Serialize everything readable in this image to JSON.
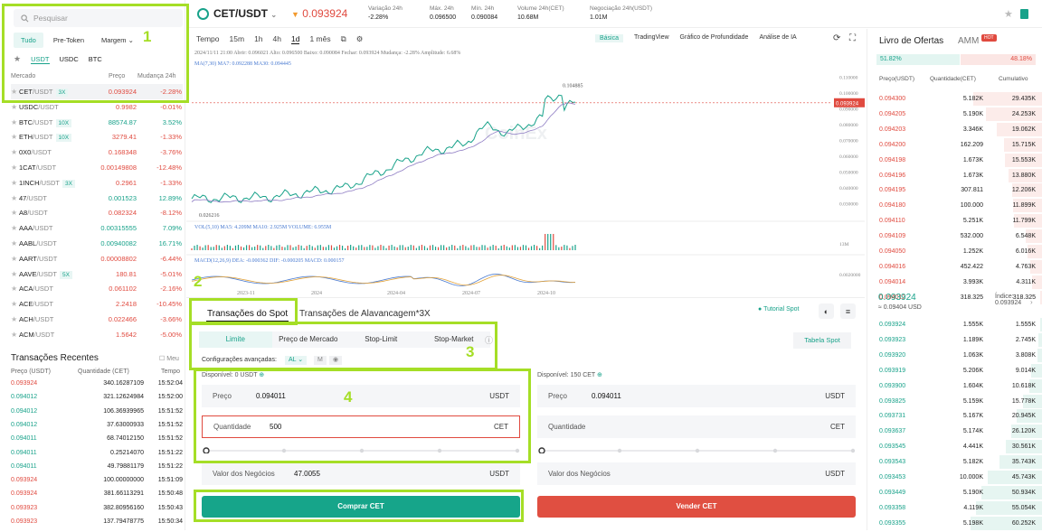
{
  "colors": {
    "up": "#18a28a",
    "down": "#e04a3f",
    "accent": "#18a28a",
    "annotation": "#a5de26"
  },
  "left": {
    "search_placeholder": "Pesquisar",
    "market_tabs": [
      "Tudo",
      "Pre-Token",
      "Margem"
    ],
    "quote_tabs": [
      "USDT",
      "USDC",
      "BTC"
    ],
    "headers": {
      "market": "Mercado",
      "price": "Preço",
      "change": "Mudança 24h"
    },
    "markets": [
      {
        "base": "CET",
        "quote": "/USDT",
        "lev": "3X",
        "price": "0.093924",
        "change": "-2.28%",
        "dir": "neg"
      },
      {
        "base": "USDC",
        "quote": "/USDT",
        "lev": "",
        "price": "0.9982",
        "change": "-0.01%",
        "dir": "neg"
      },
      {
        "base": "BTC",
        "quote": "/USDT",
        "lev": "10X",
        "price": "88574.87",
        "change": "3.52%",
        "dir": "pos"
      },
      {
        "base": "ETH",
        "quote": "/USDT",
        "lev": "10X",
        "price": "3279.41",
        "change": "-1.33%",
        "dir": "neg"
      },
      {
        "base": "0X0",
        "quote": "/USDT",
        "lev": "",
        "price": "0.168348",
        "change": "-3.76%",
        "dir": "neg"
      },
      {
        "base": "1CAT",
        "quote": "/USDT",
        "lev": "",
        "price": "0.00149808",
        "change": "-12.48%",
        "dir": "neg"
      },
      {
        "base": "1INCH",
        "quote": "/USDT",
        "lev": "3X",
        "price": "0.2961",
        "change": "-1.33%",
        "dir": "neg"
      },
      {
        "base": "47",
        "quote": "/USDT",
        "lev": "",
        "price": "0.001523",
        "change": "12.89%",
        "dir": "pos"
      },
      {
        "base": "A8",
        "quote": "/USDT",
        "lev": "",
        "price": "0.082324",
        "change": "-8.12%",
        "dir": "neg"
      },
      {
        "base": "AAA",
        "quote": "/USDT",
        "lev": "",
        "price": "0.00315555",
        "change": "7.09%",
        "dir": "pos"
      },
      {
        "base": "AABL",
        "quote": "/USDT",
        "lev": "",
        "price": "0.00940082",
        "change": "16.71%",
        "dir": "pos"
      },
      {
        "base": "AART",
        "quote": "/USDT",
        "lev": "",
        "price": "0.00008802",
        "change": "-6.44%",
        "dir": "neg"
      },
      {
        "base": "AAVE",
        "quote": "/USDT",
        "lev": "5X",
        "price": "180.81",
        "change": "-5.01%",
        "dir": "neg"
      },
      {
        "base": "ACA",
        "quote": "/USDT",
        "lev": "",
        "price": "0.061102",
        "change": "-2.16%",
        "dir": "neg"
      },
      {
        "base": "ACE",
        "quote": "/USDT",
        "lev": "",
        "price": "2.2418",
        "change": "-10.45%",
        "dir": "neg"
      },
      {
        "base": "ACH",
        "quote": "/USDT",
        "lev": "",
        "price": "0.022466",
        "change": "-3.66%",
        "dir": "neg"
      },
      {
        "base": "ACM",
        "quote": "/USDT",
        "lev": "",
        "price": "1.5642",
        "change": "-5.00%",
        "dir": "neg"
      }
    ],
    "recent_title": "Transações Recentes",
    "recent_mine": "Meu",
    "recent_headers": {
      "price": "Preço (USDT)",
      "qty": "Quantidade (CET)",
      "time": "Tempo"
    },
    "recent": [
      {
        "price": "0.093924",
        "qty": "340.16287109",
        "time": "15:52:04",
        "dir": "neg"
      },
      {
        "price": "0.094012",
        "qty": "321.12624984",
        "time": "15:52:00",
        "dir": "pos"
      },
      {
        "price": "0.094012",
        "qty": "106.36939965",
        "time": "15:51:52",
        "dir": "pos"
      },
      {
        "price": "0.094012",
        "qty": "37.63000933",
        "time": "15:51:52",
        "dir": "pos"
      },
      {
        "price": "0.094011",
        "qty": "68.74012150",
        "time": "15:51:52",
        "dir": "pos"
      },
      {
        "price": "0.094011",
        "qty": "0.25214070",
        "time": "15:51:22",
        "dir": "pos"
      },
      {
        "price": "0.094011",
        "qty": "49.79881179",
        "time": "15:51:22",
        "dir": "pos"
      },
      {
        "price": "0.093924",
        "qty": "100.00000000",
        "time": "15:51:09",
        "dir": "neg"
      },
      {
        "price": "0.093924",
        "qty": "381.66113291",
        "time": "15:50:48",
        "dir": "neg"
      },
      {
        "price": "0.093923",
        "qty": "382.80956160",
        "time": "15:50:43",
        "dir": "neg"
      },
      {
        "price": "0.093923",
        "qty": "137.79478775",
        "time": "15:50:34",
        "dir": "neg"
      }
    ]
  },
  "topbar": {
    "pair": "CET/USDT",
    "price": "0.093924",
    "stats": [
      {
        "label": "Variação 24h",
        "value": "-2.28%",
        "dir": "neg"
      },
      {
        "label": "Máx. 24h",
        "value": "0.096500",
        "dir": ""
      },
      {
        "label": "Mín. 24h",
        "value": "0.090084",
        "dir": ""
      },
      {
        "label": "Volume 24h(CET)",
        "value": "10.68M",
        "dir": ""
      },
      {
        "label": "Negociação 24h(USDT)",
        "value": "1.01M",
        "dir": ""
      }
    ]
  },
  "chart": {
    "tabs": [
      "Tempo",
      "15m",
      "1h",
      "4h",
      "1d",
      "1 mês"
    ],
    "views": [
      "Básica",
      "TradingView",
      "Gráfico de Profundidade",
      "Análise de IA"
    ],
    "info1": "2024/11/11 21:00  Abrir: 0.096021  Alto: 0.096500  Baixo: 0.090084  Fechar: 0.093924  Mudança: -2.28%  Amplitude: 6.68%",
    "ma": "MA(7,30)  MA7: 0.092288  MA30: 0.094445",
    "vol": "VOL(5,10)  MA5: 4.209M  MA10: 2.925M  VOLUME: 6.955M",
    "macd": "MACD(12,26,9)  DEA: -0.000362  DIF: -0.000205  MACD: 0.000157",
    "yticks": [
      "0.110000",
      "0.100000",
      "0.090000",
      "0.080000",
      "0.070000",
      "0.060000",
      "0.050000",
      "0.040000",
      "0.030000"
    ],
    "current_tag": "0.093924",
    "high_label": "0.104885",
    "low_label": "0.026216",
    "vol_tick": "13M",
    "macd_tick": "0.0020000",
    "xticks": [
      "2023-11",
      "2024",
      "2024-04",
      "2024-07",
      "2024-10"
    ],
    "watermark": "CoinEx"
  },
  "chart_data": {
    "type": "line",
    "title": "CET/USDT 1d",
    "x": [
      "2023-11",
      "2024",
      "2024-04",
      "2024-07",
      "2024-10",
      "2024-11"
    ],
    "series": [
      {
        "name": "Close",
        "values": [
          0.033,
          0.034,
          0.04,
          0.062,
          0.072,
          0.0939
        ]
      }
    ],
    "ylim": [
      0.025,
      0.115
    ]
  },
  "form": {
    "tab_spot": "Transações do Spot",
    "tab_margin": "Transações de Alavancagem*3X",
    "tutorial": "Tutorial Spot",
    "order_types": [
      "Limite",
      "Preço de Mercado",
      "Stop-Limit",
      "Stop-Market"
    ],
    "table_button": "Tabela Spot",
    "adv_label": "Configurações avançadas:",
    "adv_opt": "AL",
    "adv_m": "M",
    "buy": {
      "available": "Disponível: 0 USDT",
      "price_label": "Preço",
      "price": "0.094011",
      "price_unit": "USDT",
      "qty_label": "Quantidade",
      "qty": "500",
      "qty_unit": "CET",
      "total_label": "Valor dos Negócios",
      "total": "47.0055",
      "total_unit": "USDT",
      "button": "Comprar CET"
    },
    "sell": {
      "available": "Disponível: 150 CET",
      "price_label": "Preço",
      "price": "0.094011",
      "price_unit": "USDT",
      "qty_label": "Quantidade",
      "qty": "",
      "qty_unit": "CET",
      "total_label": "Valor dos Negócios",
      "total": "",
      "total_unit": "USDT",
      "button": "Vender CET"
    }
  },
  "book": {
    "title": "Livro de Ofertas",
    "amm": "AMM",
    "hot": "HOT",
    "buy_ratio": "51.82%",
    "sell_ratio": "48.18%",
    "headers": {
      "price": "Preço(USDT)",
      "qty": "Quantidade(CET)",
      "cum": "Cumulativo"
    },
    "asks": [
      {
        "p": "0.094300",
        "q": "5.182K",
        "c": "29.435K",
        "d": 0.95
      },
      {
        "p": "0.094205",
        "q": "5.190K",
        "c": "24.253K",
        "d": 0.78
      },
      {
        "p": "0.094203",
        "q": "3.346K",
        "c": "19.062K",
        "d": 0.62
      },
      {
        "p": "0.094200",
        "q": "162.209",
        "c": "15.715K",
        "d": 0.52
      },
      {
        "p": "0.094198",
        "q": "1.673K",
        "c": "15.553K",
        "d": 0.51
      },
      {
        "p": "0.094196",
        "q": "1.673K",
        "c": "13.880K",
        "d": 0.46
      },
      {
        "p": "0.094195",
        "q": "307.811",
        "c": "12.206K",
        "d": 0.41
      },
      {
        "p": "0.094180",
        "q": "100.000",
        "c": "11.899K",
        "d": 0.4
      },
      {
        "p": "0.094110",
        "q": "5.251K",
        "c": "11.799K",
        "d": 0.39
      },
      {
        "p": "0.094109",
        "q": "532.000",
        "c": "6.548K",
        "d": 0.22
      },
      {
        "p": "0.094050",
        "q": "1.252K",
        "c": "6.016K",
        "d": 0.2
      },
      {
        "p": "0.094016",
        "q": "452.422",
        "c": "4.763K",
        "d": 0.16
      },
      {
        "p": "0.094014",
        "q": "3.993K",
        "c": "4.311K",
        "d": 0.14
      },
      {
        "p": "0.094012",
        "q": "318.325",
        "c": "318.325",
        "d": 0.02
      }
    ],
    "mid": "0.093924",
    "mid_sub": "≈ 0.09404  USD",
    "index_label": "Índice:",
    "index_val": "0.093924",
    "bids": [
      {
        "p": "0.093924",
        "q": "1.555K",
        "c": "1.555K",
        "d": 0.03
      },
      {
        "p": "0.093923",
        "q": "1.189K",
        "c": "2.745K",
        "d": 0.05
      },
      {
        "p": "0.093920",
        "q": "1.063K",
        "c": "3.808K",
        "d": 0.06
      },
      {
        "p": "0.093919",
        "q": "5.206K",
        "c": "9.014K",
        "d": 0.15
      },
      {
        "p": "0.093900",
        "q": "1.604K",
        "c": "10.618K",
        "d": 0.17
      },
      {
        "p": "0.093825",
        "q": "5.159K",
        "c": "15.778K",
        "d": 0.26
      },
      {
        "p": "0.093731",
        "q": "5.167K",
        "c": "20.945K",
        "d": 0.35
      },
      {
        "p": "0.093637",
        "q": "5.174K",
        "c": "26.120K",
        "d": 0.43
      },
      {
        "p": "0.093545",
        "q": "4.441K",
        "c": "30.561K",
        "d": 0.5
      },
      {
        "p": "0.093543",
        "q": "5.182K",
        "c": "35.743K",
        "d": 0.59
      },
      {
        "p": "0.093453",
        "q": "10.000K",
        "c": "45.743K",
        "d": 0.75
      },
      {
        "p": "0.093449",
        "q": "5.190K",
        "c": "50.934K",
        "d": 0.84
      },
      {
        "p": "0.093358",
        "q": "4.119K",
        "c": "55.054K",
        "d": 0.91
      },
      {
        "p": "0.093355",
        "q": "5.198K",
        "c": "60.252K",
        "d": 0.99
      }
    ]
  },
  "annotations": [
    "1",
    "2",
    "3",
    "4"
  ]
}
